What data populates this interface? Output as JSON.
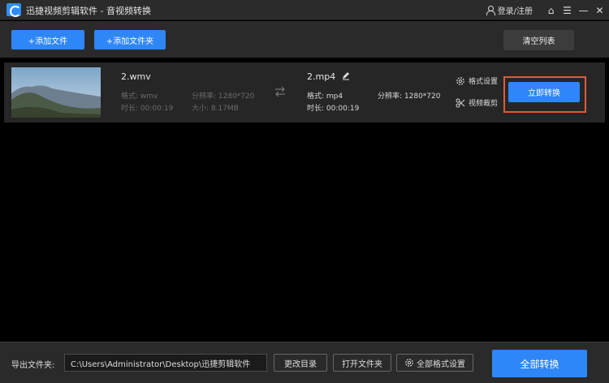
{
  "window": {
    "app_name": "迅捷视频剪辑软件",
    "separator": " - ",
    "section": "音视频转换",
    "login_label": "登录/注册",
    "controls": [
      "⌂",
      "☰",
      "—",
      "✕"
    ]
  },
  "toolbar": {
    "add_file_label": "+添加文件",
    "add_folder_label": "+添加文件夹",
    "clear_list_label": "清空列表"
  },
  "files": [
    {
      "source": {
        "name": "2.wmv",
        "format_label": "格式: wmv",
        "resolution_label": "分辨率: 1280*720",
        "duration_label": "时长: 00:00:19",
        "size_label": "大小: 8.17MB"
      },
      "target": {
        "name": "2.mp4",
        "format_label": "格式: mp4",
        "resolution_label": "分辨率: 1280*720",
        "duration_label": "时长: 00:00:19"
      },
      "actions": {
        "format_settings_label": "格式设置",
        "video_trim_label": "视频裁剪",
        "convert_now_label": "立即转换"
      }
    }
  ],
  "footer": {
    "output_folder_label": "导出文件夹:",
    "output_path": "C:\\Users\\Administrator\\Desktop\\迅捷剪辑软件",
    "change_dir_label": "更改目录",
    "open_folder_label": "打开文件夹",
    "all_format_settings_label": "全部格式设置",
    "convert_all_label": "全部转换"
  },
  "colors": {
    "accent": "#2f86f6",
    "highlight": "#e05a3a",
    "row_bg": "#262626"
  }
}
